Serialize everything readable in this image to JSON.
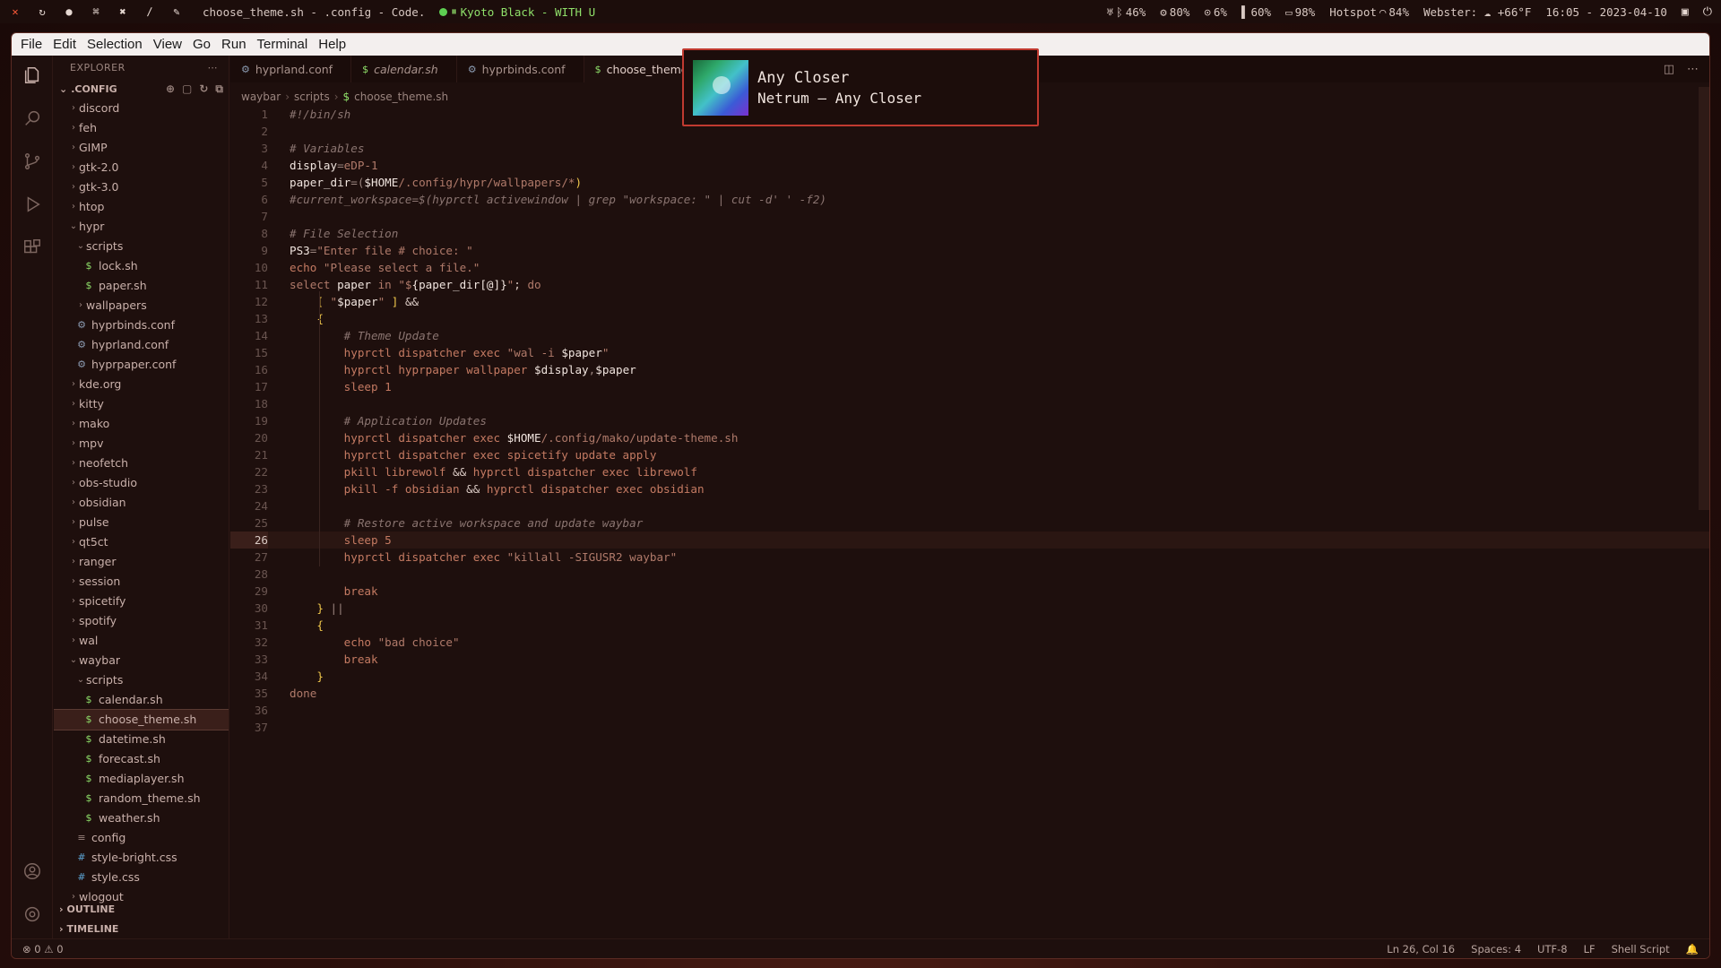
{
  "waybar": {
    "window_title": "choose_theme.sh - .config - Code.",
    "media": "Kyoto Black - WITH U",
    "audio": "46%",
    "cpu": "80%",
    "ram": "6%",
    "battery_device": "60%",
    "battery": "98%",
    "network": "Hotspot",
    "wifi_strength": "84%",
    "weather": "Webster: ☁ +66°F",
    "datetime": "16:05 - 2023-04-10"
  },
  "menubar": [
    "File",
    "Edit",
    "Selection",
    "View",
    "Go",
    "Run",
    "Terminal",
    "Help"
  ],
  "sidebar": {
    "header": "EXPLORER",
    "root": ".CONFIG",
    "outline": "OUTLINE",
    "timeline": "TIMELINE",
    "tree": [
      {
        "label": "discord",
        "type": "folder",
        "depth": 0,
        "open": false
      },
      {
        "label": "feh",
        "type": "folder",
        "depth": 0,
        "open": false
      },
      {
        "label": "GIMP",
        "type": "folder",
        "depth": 0,
        "open": false
      },
      {
        "label": "gtk-2.0",
        "type": "folder",
        "depth": 0,
        "open": false
      },
      {
        "label": "gtk-3.0",
        "type": "folder",
        "depth": 0,
        "open": false
      },
      {
        "label": "htop",
        "type": "folder",
        "depth": 0,
        "open": false
      },
      {
        "label": "hypr",
        "type": "folder",
        "depth": 0,
        "open": true
      },
      {
        "label": "scripts",
        "type": "folder",
        "depth": 1,
        "open": true
      },
      {
        "label": "lock.sh",
        "type": "sh",
        "depth": 2
      },
      {
        "label": "paper.sh",
        "type": "sh",
        "depth": 2
      },
      {
        "label": "wallpapers",
        "type": "folder",
        "depth": 1,
        "open": false
      },
      {
        "label": "hyprbinds.conf",
        "type": "gear",
        "depth": 1
      },
      {
        "label": "hyprland.conf",
        "type": "gear",
        "depth": 1
      },
      {
        "label": "hyprpaper.conf",
        "type": "gear",
        "depth": 1
      },
      {
        "label": "kde.org",
        "type": "folder",
        "depth": 0,
        "open": false
      },
      {
        "label": "kitty",
        "type": "folder",
        "depth": 0,
        "open": false
      },
      {
        "label": "mako",
        "type": "folder",
        "depth": 0,
        "open": false
      },
      {
        "label": "mpv",
        "type": "folder",
        "depth": 0,
        "open": false
      },
      {
        "label": "neofetch",
        "type": "folder",
        "depth": 0,
        "open": false
      },
      {
        "label": "obs-studio",
        "type": "folder",
        "depth": 0,
        "open": false
      },
      {
        "label": "obsidian",
        "type": "folder",
        "depth": 0,
        "open": false
      },
      {
        "label": "pulse",
        "type": "folder",
        "depth": 0,
        "open": false
      },
      {
        "label": "qt5ct",
        "type": "folder",
        "depth": 0,
        "open": false
      },
      {
        "label": "ranger",
        "type": "folder",
        "depth": 0,
        "open": false
      },
      {
        "label": "session",
        "type": "folder",
        "depth": 0,
        "open": false
      },
      {
        "label": "spicetify",
        "type": "folder",
        "depth": 0,
        "open": false
      },
      {
        "label": "spotify",
        "type": "folder",
        "depth": 0,
        "open": false
      },
      {
        "label": "wal",
        "type": "folder",
        "depth": 0,
        "open": false
      },
      {
        "label": "waybar",
        "type": "folder",
        "depth": 0,
        "open": true
      },
      {
        "label": "scripts",
        "type": "folder",
        "depth": 1,
        "open": true
      },
      {
        "label": "calendar.sh",
        "type": "sh",
        "depth": 2
      },
      {
        "label": "choose_theme.sh",
        "type": "sh",
        "depth": 2,
        "selected": true
      },
      {
        "label": "datetime.sh",
        "type": "sh",
        "depth": 2
      },
      {
        "label": "forecast.sh",
        "type": "sh",
        "depth": 2
      },
      {
        "label": "mediaplayer.sh",
        "type": "sh",
        "depth": 2
      },
      {
        "label": "random_theme.sh",
        "type": "sh",
        "depth": 2
      },
      {
        "label": "weather.sh",
        "type": "sh",
        "depth": 2
      },
      {
        "label": "config",
        "type": "conf",
        "depth": 1
      },
      {
        "label": "style-bright.css",
        "type": "css",
        "depth": 1
      },
      {
        "label": "style.css",
        "type": "css",
        "depth": 1
      },
      {
        "label": "wlogout",
        "type": "folder",
        "depth": 0,
        "open": false
      }
    ]
  },
  "tabs": [
    {
      "label": "hyprland.conf",
      "icon": "gear",
      "italic": false,
      "active": false
    },
    {
      "label": "calendar.sh",
      "icon": "sh",
      "italic": true,
      "active": false
    },
    {
      "label": "hyprbinds.conf",
      "icon": "gear",
      "italic": false,
      "active": false
    },
    {
      "label": "choose_theme",
      "icon": "sh",
      "italic": false,
      "active": true
    }
  ],
  "breadcrumb": [
    "waybar",
    "scripts",
    "choose_theme.sh"
  ],
  "code": {
    "current_line": 26,
    "lines": [
      [
        [
          "t-cmt",
          "#!/bin/sh"
        ]
      ],
      [],
      [
        [
          "t-cmt",
          "# Variables"
        ]
      ],
      [
        [
          "t-var",
          "display"
        ],
        [
          "t-op",
          "="
        ],
        [
          "t-str",
          "eDP-1"
        ]
      ],
      [
        [
          "t-var",
          "paper_dir"
        ],
        [
          "t-op",
          "=("
        ],
        [
          "t-var",
          "$HOME"
        ],
        [
          "t-str",
          "/.config/hypr/wallpapers/*"
        ],
        [
          "t-brace",
          ")"
        ]
      ],
      [
        [
          "t-cmt",
          "#current_workspace=$(hyprctl activewindow | grep \"workspace: \" | cut -d' ' -f2)"
        ]
      ],
      [],
      [
        [
          "t-cmt",
          "# File Selection"
        ]
      ],
      [
        [
          "t-var",
          "PS3"
        ],
        [
          "t-op",
          "="
        ],
        [
          "t-str",
          "\"Enter file # choice: \""
        ]
      ],
      [
        [
          "t-fn",
          "echo "
        ],
        [
          "t-str",
          "\"Please select a file.\""
        ]
      ],
      [
        [
          "t-kw",
          "select "
        ],
        [
          "t-var",
          "paper"
        ],
        [
          "t-kw",
          " in "
        ],
        [
          "t-str",
          "\"$"
        ],
        [
          "t-var",
          "{paper_dir[@]}"
        ],
        [
          "t-str",
          "\""
        ],
        [
          "t-plain",
          "; "
        ],
        [
          "t-kw",
          "do"
        ]
      ],
      [
        [
          "t-plain",
          "    "
        ],
        [
          "t-brace",
          "[ "
        ],
        [
          "t-str",
          "\""
        ],
        [
          "t-var",
          "$paper"
        ],
        [
          "t-str",
          "\""
        ],
        [
          "t-brace",
          " ]"
        ],
        [
          "t-plain",
          " &&"
        ]
      ],
      [
        [
          "t-plain",
          "    "
        ],
        [
          "t-brace",
          "{"
        ]
      ],
      [
        [
          "t-plain",
          "        "
        ],
        [
          "t-cmt",
          "# Theme Update"
        ]
      ],
      [
        [
          "t-plain",
          "        "
        ],
        [
          "t-fn",
          "hyprctl dispatcher exec "
        ],
        [
          "t-str",
          "\"wal -i "
        ],
        [
          "t-var",
          "$paper"
        ],
        [
          "t-str",
          "\""
        ]
      ],
      [
        [
          "t-plain",
          "        "
        ],
        [
          "t-fn",
          "hyprctl hyprpaper wallpaper "
        ],
        [
          "t-var",
          "$display"
        ],
        [
          "t-op",
          ","
        ],
        [
          "t-var",
          "$paper"
        ]
      ],
      [
        [
          "t-plain",
          "        "
        ],
        [
          "t-fn",
          "sleep 1"
        ]
      ],
      [],
      [
        [
          "t-plain",
          "        "
        ],
        [
          "t-cmt",
          "# Application Updates"
        ]
      ],
      [
        [
          "t-plain",
          "        "
        ],
        [
          "t-fn",
          "hyprctl dispatcher exec "
        ],
        [
          "t-var",
          "$HOME"
        ],
        [
          "t-str",
          "/.config/mako/update-theme.sh"
        ]
      ],
      [
        [
          "t-plain",
          "        "
        ],
        [
          "t-fn",
          "hyprctl dispatcher exec spicetify update apply"
        ]
      ],
      [
        [
          "t-plain",
          "        "
        ],
        [
          "t-fn",
          "pkill librewolf "
        ],
        [
          "t-plain",
          "&& "
        ],
        [
          "t-fn",
          "hyprctl dispatcher exec librewolf"
        ]
      ],
      [
        [
          "t-plain",
          "        "
        ],
        [
          "t-fn",
          "pkill -f obsidian "
        ],
        [
          "t-plain",
          "&& "
        ],
        [
          "t-fn",
          "hyprctl dispatcher exec obsidian"
        ]
      ],
      [],
      [
        [
          "t-plain",
          "        "
        ],
        [
          "t-cmt",
          "# Restore active workspace and update waybar"
        ]
      ],
      [
        [
          "t-plain",
          "        "
        ],
        [
          "t-fn",
          "sleep 5"
        ]
      ],
      [
        [
          "t-plain",
          "        "
        ],
        [
          "t-fn",
          "hyprctl dispatcher exec "
        ],
        [
          "t-str",
          "\"killall -SIGUSR2 waybar\""
        ]
      ],
      [],
      [
        [
          "t-plain",
          "        "
        ],
        [
          "t-fn",
          "break"
        ]
      ],
      [
        [
          "t-plain",
          "    "
        ],
        [
          "t-brace",
          "}"
        ],
        [
          "t-op",
          " ||"
        ]
      ],
      [
        [
          "t-plain",
          "    "
        ],
        [
          "t-brace",
          "{"
        ]
      ],
      [
        [
          "t-plain",
          "        "
        ],
        [
          "t-fn",
          "echo "
        ],
        [
          "t-str",
          "\"bad choice\""
        ]
      ],
      [
        [
          "t-plain",
          "        "
        ],
        [
          "t-fn",
          "break"
        ]
      ],
      [
        [
          "t-plain",
          "    "
        ],
        [
          "t-brace",
          "}"
        ]
      ],
      [
        [
          "t-kw",
          "done"
        ]
      ],
      [],
      []
    ]
  },
  "statusbar": {
    "errors": "0",
    "warnings": "0",
    "position": "Ln 26, Col 16",
    "spaces": "Spaces: 4",
    "encoding": "UTF-8",
    "eol": "LF",
    "language": "Shell Script"
  },
  "notification": {
    "title": "Any Closer",
    "body": "Netrum – Any Closer"
  }
}
